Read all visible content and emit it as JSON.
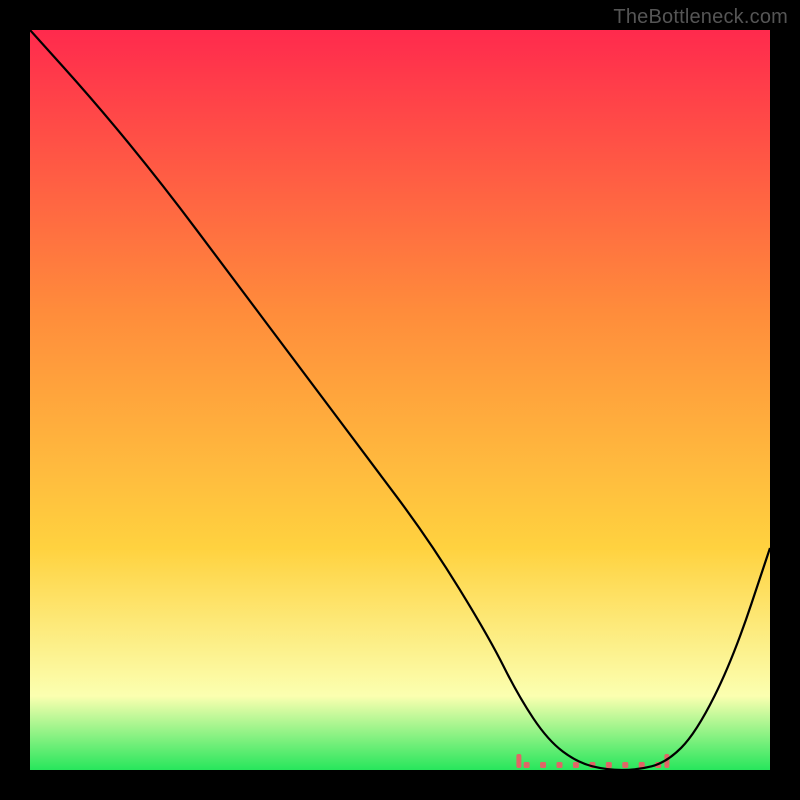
{
  "watermark": "TheBottleneck.com",
  "chart_data": {
    "type": "line",
    "title": "",
    "xlabel": "",
    "ylabel": "",
    "xlim": [
      0,
      100
    ],
    "ylim": [
      0,
      100
    ],
    "grid": false,
    "legend": false,
    "background_gradient": {
      "top": "#ff2a4d",
      "mid": "#ffd23f",
      "bottom": "#27e65c"
    },
    "series": [
      {
        "name": "curve",
        "color": "#000000",
        "x": [
          0,
          9,
          18,
          27,
          36,
          45,
          54,
          62,
          66,
          70,
          74,
          78,
          82,
          86,
          90,
          95,
          100
        ],
        "y": [
          100,
          90,
          79,
          67,
          55,
          43,
          31,
          18,
          10,
          4,
          1,
          0,
          0,
          1,
          5,
          15,
          30
        ]
      }
    ],
    "optimum_band": {
      "name": "optimum-range-markers",
      "color": "#e06666",
      "x_start": 66,
      "x_end": 86,
      "y_baseline": 0
    }
  }
}
